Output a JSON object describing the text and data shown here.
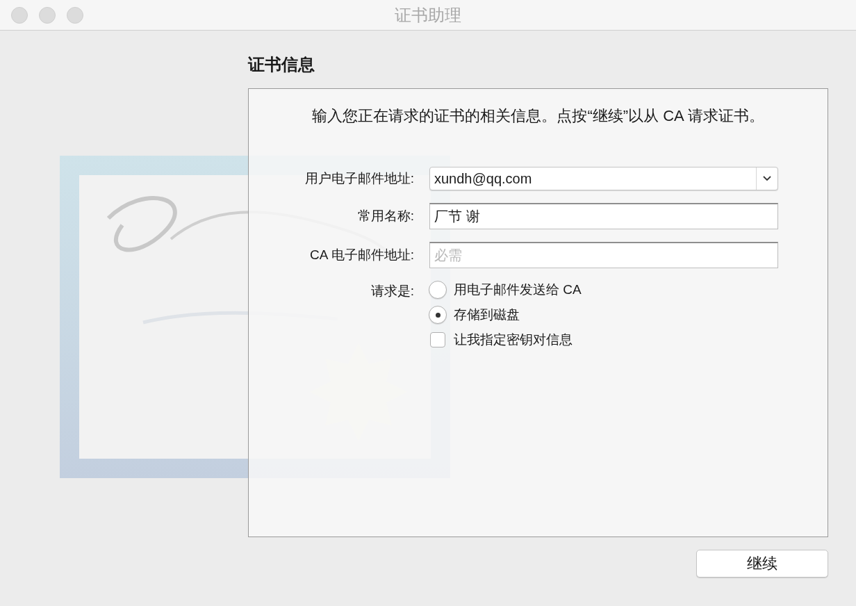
{
  "window": {
    "title": "证书助理"
  },
  "section_title": "证书信息",
  "panel": {
    "instruction": "输入您正在请求的证书的相关信息。点按“继续”以从 CA 请求证书。",
    "fields": [
      {
        "label": "用户电子邮件地址:",
        "kind": "combo",
        "value": "xundh@qq.com"
      },
      {
        "label": "常用名称:",
        "kind": "text",
        "value": "厂节 谢"
      },
      {
        "label": "CA 电子邮件地址:",
        "kind": "text",
        "placeholder": "必需"
      }
    ],
    "request": {
      "label": "请求是:",
      "options": [
        {
          "label": "用电子邮件发送给 CA",
          "selected": false
        },
        {
          "label": "存储到磁盘",
          "selected": true
        }
      ]
    },
    "key_option": {
      "label": "让我指定密钥对信息",
      "checked": false
    }
  },
  "continue_button": "继续"
}
